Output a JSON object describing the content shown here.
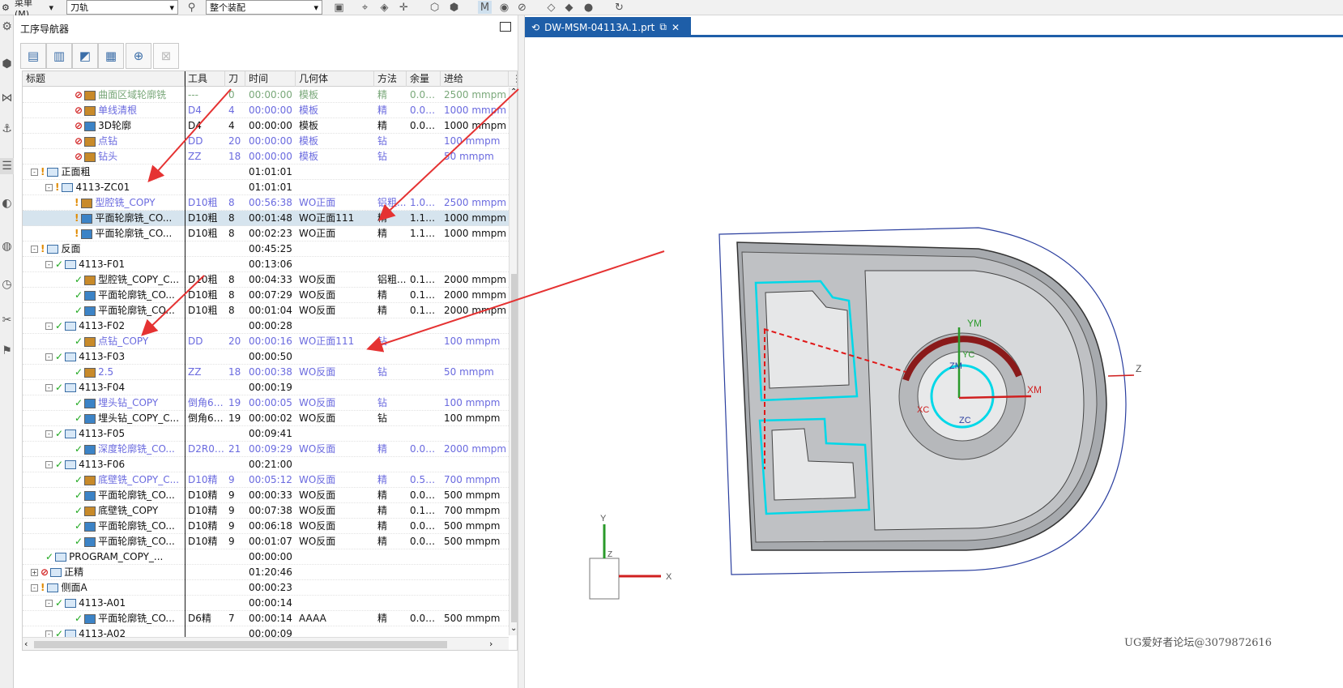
{
  "toolbar": {
    "menu_label": "菜单(M)",
    "filter_select": "刀轨",
    "assembly_select": "整个装配"
  },
  "nav": {
    "title": "工序导航器",
    "columns": [
      "标题",
      "工具",
      "刀",
      "时间",
      "几何体",
      "方法",
      "余量",
      "进给"
    ],
    "rows": [
      {
        "depth": 4,
        "exp": "",
        "status": "no",
        "icon": "o",
        "title": "曲面区域轮廓铣",
        "tool": "---",
        "knife": "0",
        "time": "00:00:00",
        "geom": "模板",
        "method": "精",
        "stock": "0.00...",
        "feed": "2500 mmpm",
        "style": "gray"
      },
      {
        "depth": 4,
        "exp": "",
        "status": "no",
        "icon": "o",
        "title": "单线清根",
        "tool": "D4",
        "knife": "4",
        "time": "00:00:00",
        "geom": "模板",
        "method": "精",
        "stock": "0.00...",
        "feed": "1000 mmpm",
        "style": "blue"
      },
      {
        "depth": 4,
        "exp": "",
        "status": "no",
        "icon": "b",
        "title": "3D轮廓",
        "tool": "D4",
        "knife": "4",
        "time": "00:00:00",
        "geom": "模板",
        "method": "精",
        "stock": "0.00...",
        "feed": "1000 mmpm",
        "style": ""
      },
      {
        "depth": 4,
        "exp": "",
        "status": "no",
        "icon": "o",
        "title": "点钻",
        "tool": "DD",
        "knife": "20",
        "time": "00:00:00",
        "geom": "模板",
        "method": "钻",
        "stock": "",
        "feed": "100 mmpm",
        "style": "blue"
      },
      {
        "depth": 4,
        "exp": "",
        "status": "no",
        "icon": "o",
        "title": "钻头",
        "tool": "ZZ",
        "knife": "18",
        "time": "00:00:00",
        "geom": "模板",
        "method": "钻",
        "stock": "",
        "feed": "50 mmpm",
        "style": "blue"
      },
      {
        "depth": 1,
        "exp": "-",
        "status": "warn",
        "icon": "f",
        "title": "正面粗",
        "tool": "",
        "knife": "",
        "time": "01:01:01",
        "geom": "",
        "method": "",
        "stock": "",
        "feed": "",
        "style": ""
      },
      {
        "depth": 2,
        "exp": "-",
        "status": "warn",
        "icon": "f",
        "title": "4113-ZC01",
        "tool": "",
        "knife": "",
        "time": "01:01:01",
        "geom": "",
        "method": "",
        "stock": "",
        "feed": "",
        "style": ""
      },
      {
        "depth": 4,
        "exp": "",
        "status": "warn",
        "icon": "o",
        "title": "型腔铣_COPY",
        "tool": "D10粗",
        "knife": "8",
        "time": "00:56:38",
        "geom": "WO正面",
        "method": "铝粗...",
        "stock": "1.00...",
        "feed": "2500 mmpm",
        "style": "blue"
      },
      {
        "depth": 4,
        "exp": "",
        "status": "warn",
        "icon": "b",
        "title": "平面轮廓铣_CO...",
        "tool": "D10粗",
        "knife": "8",
        "time": "00:01:48",
        "geom": "WO正面111",
        "method": "精",
        "stock": "1.10...",
        "feed": "1000 mmpm",
        "style": "sel"
      },
      {
        "depth": 4,
        "exp": "",
        "status": "warn",
        "icon": "b",
        "title": "平面轮廓铣_CO...",
        "tool": "D10粗",
        "knife": "8",
        "time": "00:02:23",
        "geom": "WO正面",
        "method": "精",
        "stock": "1.10...",
        "feed": "1000 mmpm",
        "style": ""
      },
      {
        "depth": 1,
        "exp": "-",
        "status": "warn",
        "icon": "f",
        "title": "反面",
        "tool": "",
        "knife": "",
        "time": "00:45:25",
        "geom": "",
        "method": "",
        "stock": "",
        "feed": "",
        "style": ""
      },
      {
        "depth": 2,
        "exp": "-",
        "status": "chk",
        "icon": "f",
        "title": "4113-F01",
        "tool": "",
        "knife": "",
        "time": "00:13:06",
        "geom": "",
        "method": "",
        "stock": "",
        "feed": "",
        "style": ""
      },
      {
        "depth": 4,
        "exp": "",
        "status": "chk",
        "icon": "o",
        "title": "型腔铣_COPY_C...",
        "tool": "D10粗",
        "knife": "8",
        "time": "00:04:33",
        "geom": "WO反面",
        "method": "铝粗...",
        "stock": "0.10...",
        "feed": "2000 mmpm",
        "style": ""
      },
      {
        "depth": 4,
        "exp": "",
        "status": "chk",
        "icon": "b",
        "title": "平面轮廓铣_CO...",
        "tool": "D10粗",
        "knife": "8",
        "time": "00:07:29",
        "geom": "WO反面",
        "method": "精",
        "stock": "0.10...",
        "feed": "2000 mmpm",
        "style": ""
      },
      {
        "depth": 4,
        "exp": "",
        "status": "chk",
        "icon": "b",
        "title": "平面轮廓铣_CO...",
        "tool": "D10粗",
        "knife": "8",
        "time": "00:01:04",
        "geom": "WO反面",
        "method": "精",
        "stock": "0.10...",
        "feed": "2000 mmpm",
        "style": ""
      },
      {
        "depth": 2,
        "exp": "-",
        "status": "chk",
        "icon": "f",
        "title": "4113-F02",
        "tool": "",
        "knife": "",
        "time": "00:00:28",
        "geom": "",
        "method": "",
        "stock": "",
        "feed": "",
        "style": ""
      },
      {
        "depth": 4,
        "exp": "",
        "status": "chk",
        "icon": "o",
        "title": "点钻_COPY",
        "tool": "DD",
        "knife": "20",
        "time": "00:00:16",
        "geom": "WO正面111",
        "method": "钻",
        "stock": "",
        "feed": "100 mmpm",
        "style": "blue"
      },
      {
        "depth": 2,
        "exp": "-",
        "status": "chk",
        "icon": "f",
        "title": "4113-F03",
        "tool": "",
        "knife": "",
        "time": "00:00:50",
        "geom": "",
        "method": "",
        "stock": "",
        "feed": "",
        "style": ""
      },
      {
        "depth": 4,
        "exp": "",
        "status": "chk",
        "icon": "o",
        "title": "2.5",
        "tool": "ZZ",
        "knife": "18",
        "time": "00:00:38",
        "geom": "WO反面",
        "method": "钻",
        "stock": "",
        "feed": "50 mmpm",
        "style": "blue"
      },
      {
        "depth": 2,
        "exp": "-",
        "status": "chk",
        "icon": "f",
        "title": "4113-F04",
        "tool": "",
        "knife": "",
        "time": "00:00:19",
        "geom": "",
        "method": "",
        "stock": "",
        "feed": "",
        "style": ""
      },
      {
        "depth": 4,
        "exp": "",
        "status": "chk",
        "icon": "b",
        "title": "埋头钻_COPY",
        "tool": "倒角6-...",
        "knife": "19",
        "time": "00:00:05",
        "geom": "WO反面",
        "method": "钻",
        "stock": "",
        "feed": "100 mmpm",
        "style": "blue"
      },
      {
        "depth": 4,
        "exp": "",
        "status": "chk",
        "icon": "b",
        "title": "埋头钻_COPY_C...",
        "tool": "倒角6-...",
        "knife": "19",
        "time": "00:00:02",
        "geom": "WO反面",
        "method": "钻",
        "stock": "",
        "feed": "100 mmpm",
        "style": ""
      },
      {
        "depth": 2,
        "exp": "-",
        "status": "chk",
        "icon": "f",
        "title": "4113-F05",
        "tool": "",
        "knife": "",
        "time": "00:09:41",
        "geom": "",
        "method": "",
        "stock": "",
        "feed": "",
        "style": ""
      },
      {
        "depth": 4,
        "exp": "",
        "status": "chk",
        "icon": "b",
        "title": "深度轮廓铣_CO...",
        "tool": "D2R0....",
        "knife": "21",
        "time": "00:09:29",
        "geom": "WO反面",
        "method": "精",
        "stock": "0.00...",
        "feed": "2000 mmpm",
        "style": "blue"
      },
      {
        "depth": 2,
        "exp": "-",
        "status": "chk",
        "icon": "f",
        "title": "4113-F06",
        "tool": "",
        "knife": "",
        "time": "00:21:00",
        "geom": "",
        "method": "",
        "stock": "",
        "feed": "",
        "style": ""
      },
      {
        "depth": 4,
        "exp": "",
        "status": "chk",
        "icon": "o",
        "title": "底壁铣_COPY_C...",
        "tool": "D10精",
        "knife": "9",
        "time": "00:05:12",
        "geom": "WO反面",
        "method": "精",
        "stock": "0.50...",
        "feed": "700 mmpm",
        "style": "blue"
      },
      {
        "depth": 4,
        "exp": "",
        "status": "chk",
        "icon": "b",
        "title": "平面轮廓铣_CO...",
        "tool": "D10精",
        "knife": "9",
        "time": "00:00:33",
        "geom": "WO反面",
        "method": "精",
        "stock": "0.00...",
        "feed": "500 mmpm",
        "style": ""
      },
      {
        "depth": 4,
        "exp": "",
        "status": "chk",
        "icon": "o",
        "title": "底壁铣_COPY",
        "tool": "D10精",
        "knife": "9",
        "time": "00:07:38",
        "geom": "WO反面",
        "method": "精",
        "stock": "0.10...",
        "feed": "700 mmpm",
        "style": ""
      },
      {
        "depth": 4,
        "exp": "",
        "status": "chk",
        "icon": "b",
        "title": "平面轮廓铣_CO...",
        "tool": "D10精",
        "knife": "9",
        "time": "00:06:18",
        "geom": "WO反面",
        "method": "精",
        "stock": "0.00...",
        "feed": "500 mmpm",
        "style": ""
      },
      {
        "depth": 4,
        "exp": "",
        "status": "chk",
        "icon": "b",
        "title": "平面轮廓铣_CO...",
        "tool": "D10精",
        "knife": "9",
        "time": "00:01:07",
        "geom": "WO反面",
        "method": "精",
        "stock": "0.00...",
        "feed": "500 mmpm",
        "style": ""
      },
      {
        "depth": 2,
        "exp": "",
        "status": "chk",
        "icon": "f",
        "title": "PROGRAM_COPY_...",
        "tool": "",
        "knife": "",
        "time": "00:00:00",
        "geom": "",
        "method": "",
        "stock": "",
        "feed": "",
        "style": ""
      },
      {
        "depth": 1,
        "exp": "+",
        "status": "no",
        "icon": "f",
        "title": "正精",
        "tool": "",
        "knife": "",
        "time": "01:20:46",
        "geom": "",
        "method": "",
        "stock": "",
        "feed": "",
        "style": ""
      },
      {
        "depth": 1,
        "exp": "-",
        "status": "warn",
        "icon": "f",
        "title": "侧面A",
        "tool": "",
        "knife": "",
        "time": "00:00:23",
        "geom": "",
        "method": "",
        "stock": "",
        "feed": "",
        "style": ""
      },
      {
        "depth": 2,
        "exp": "-",
        "status": "chk",
        "icon": "f",
        "title": "4113-A01",
        "tool": "",
        "knife": "",
        "time": "00:00:14",
        "geom": "",
        "method": "",
        "stock": "",
        "feed": "",
        "style": ""
      },
      {
        "depth": 4,
        "exp": "",
        "status": "chk",
        "icon": "b",
        "title": "平面轮廓铣_CO...",
        "tool": "D6精",
        "knife": "7",
        "time": "00:00:14",
        "geom": "AAAA",
        "method": "精",
        "stock": "0.05...",
        "feed": "500 mmpm",
        "style": ""
      },
      {
        "depth": 2,
        "exp": "-",
        "status": "chk",
        "icon": "f",
        "title": "4113-A02",
        "tool": "",
        "knife": "",
        "time": "00:00:09",
        "geom": "",
        "method": "",
        "stock": "",
        "feed": "",
        "style": ""
      }
    ]
  },
  "viewport": {
    "tab_label": "DW-MSM-04113A.1.prt",
    "axis_labels": {
      "ym": "YM",
      "xm": "XM",
      "zc": "ZC",
      "xc": "XC",
      "yc": "YC",
      "zm": "ZM",
      "z": "Z",
      "tri_y": "Y",
      "tri_x": "X",
      "tri_z": "Z"
    }
  },
  "watermark": "UG爱好者论坛@3079872616",
  "colors": {
    "accent": "#1e5ea8",
    "annotation_arrow": "#e53232",
    "toolpath": "#00d8e8"
  }
}
